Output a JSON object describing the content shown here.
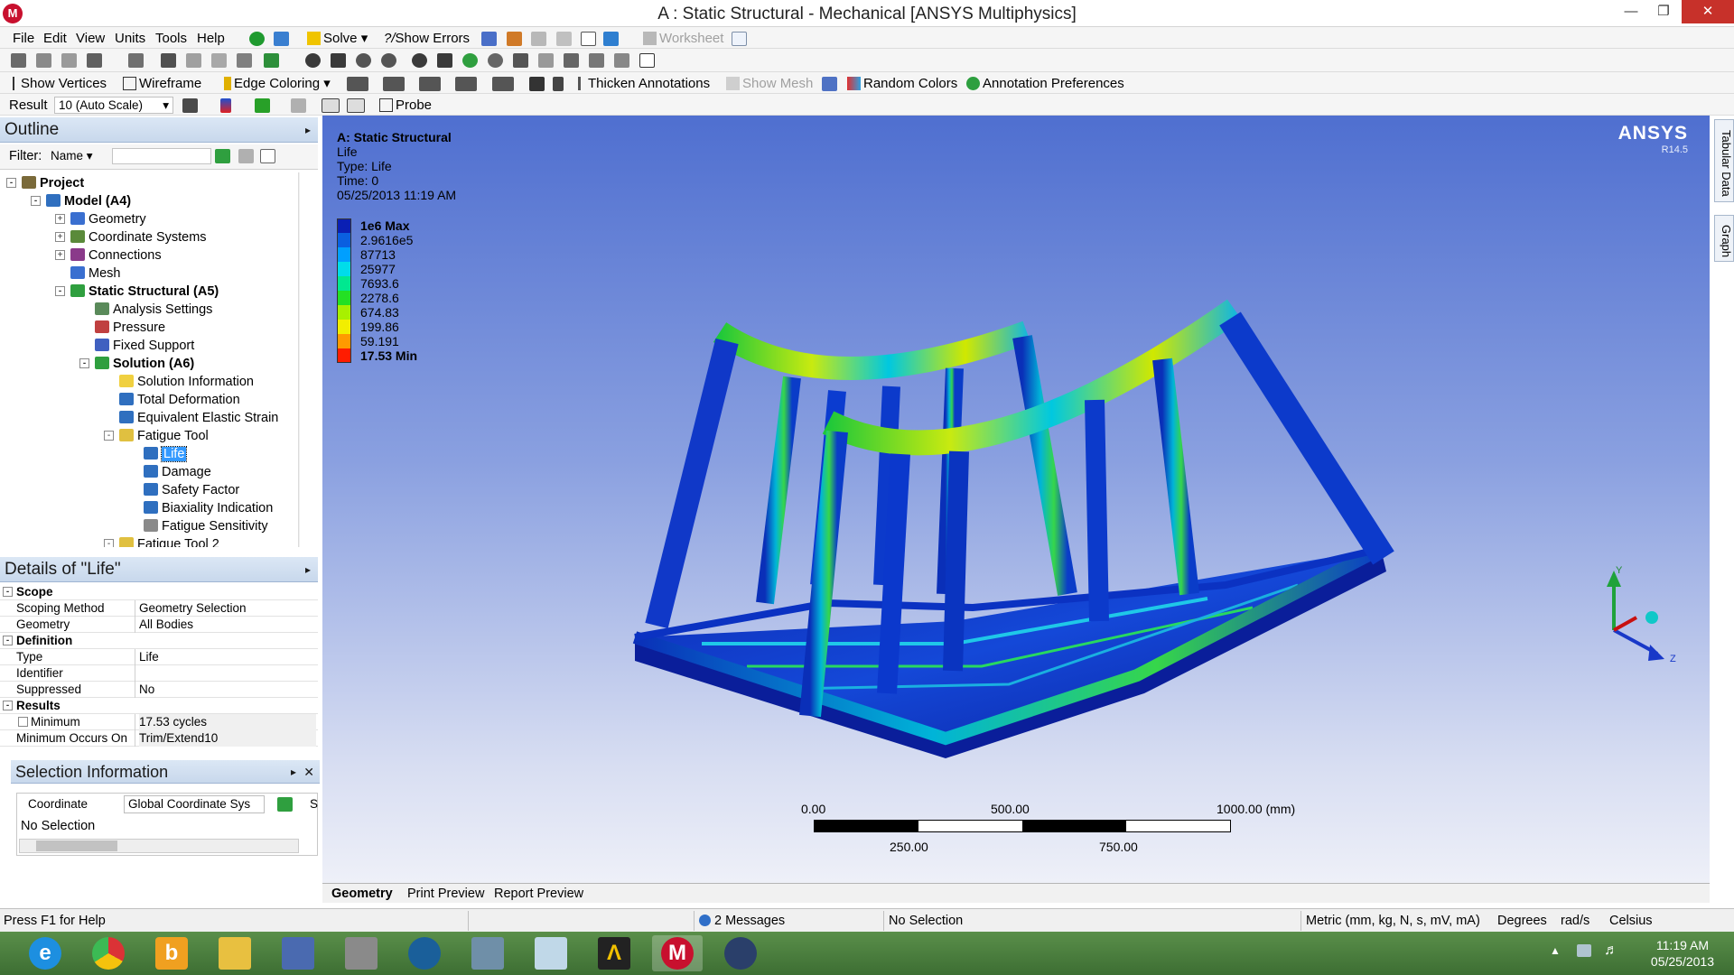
{
  "window": {
    "title": "A : Static Structural - Mechanical [ANSYS Multiphysics]",
    "app_icon_letter": "M"
  },
  "menu": {
    "items": [
      "File",
      "Edit",
      "View",
      "Units",
      "Tools",
      "Help"
    ],
    "solve": "Solve",
    "show_errors": "Show Errors",
    "worksheet": "Worksheet"
  },
  "toolbar2": {},
  "toolbar3": {
    "show_vertices": "Show Vertices",
    "wireframe": "Wireframe",
    "edge_coloring": "Edge Coloring",
    "thicken_annotations": "Thicken Annotations",
    "show_mesh": "Show Mesh",
    "random_colors": "Random Colors",
    "annotation_preferences": "Annotation Preferences"
  },
  "result_bar": {
    "label": "Result",
    "scale_value": "10 (Auto Scale)",
    "probe": "Probe"
  },
  "outline": {
    "title": "Outline",
    "filter_label": "Filter:",
    "filter_value": "Name",
    "tree": [
      {
        "label": "Project",
        "bold": true
      },
      {
        "label": "Model (A4)",
        "bold": true
      },
      {
        "label": "Geometry"
      },
      {
        "label": "Coordinate Systems"
      },
      {
        "label": "Connections"
      },
      {
        "label": "Mesh"
      },
      {
        "label": "Static Structural (A5)",
        "bold": true
      },
      {
        "label": "Analysis Settings"
      },
      {
        "label": "Pressure"
      },
      {
        "label": "Fixed Support"
      },
      {
        "label": "Solution (A6)",
        "bold": true
      },
      {
        "label": "Solution Information"
      },
      {
        "label": "Total Deformation"
      },
      {
        "label": "Equivalent Elastic Strain"
      },
      {
        "label": "Fatigue Tool"
      },
      {
        "label": "Life",
        "selected": true
      },
      {
        "label": "Damage"
      },
      {
        "label": "Safety Factor"
      },
      {
        "label": "Biaxiality Indication"
      },
      {
        "label": "Fatigue Sensitivity"
      },
      {
        "label": "Fatigue Tool 2"
      }
    ]
  },
  "details": {
    "title": "Details of \"Life\"",
    "groups": [
      {
        "name": "Scope",
        "rows": [
          [
            "Scoping Method",
            "Geometry Selection"
          ],
          [
            "Geometry",
            "All Bodies"
          ]
        ]
      },
      {
        "name": "Definition",
        "rows": [
          [
            "Type",
            "Life"
          ],
          [
            "Identifier",
            ""
          ],
          [
            "Suppressed",
            "No"
          ]
        ]
      },
      {
        "name": "Results",
        "rows": [
          [
            "Minimum",
            "17.53 cycles"
          ],
          [
            "Minimum Occurs On",
            "Trim/Extend10"
          ]
        ]
      }
    ]
  },
  "selection_info": {
    "title": "Selection Information",
    "coordinate_label": "Coordinate",
    "coordinate_value": "Global Coordinate Sys",
    "trailing": "S",
    "no_selection": "No Selection"
  },
  "viewport": {
    "info": [
      "A: Static Structural",
      "Life",
      "Type: Life",
      "Time: 0",
      "05/25/2013 11:19 AM"
    ],
    "legend": [
      {
        "label": "1e6 Max",
        "color": "#0a1fb4",
        "bold": true
      },
      {
        "label": "2.9616e5",
        "color": "#0a5fe0"
      },
      {
        "label": "87713",
        "color": "#009fff"
      },
      {
        "label": "25977",
        "color": "#00dcea"
      },
      {
        "label": "7693.6",
        "color": "#00e890"
      },
      {
        "label": "2278.6",
        "color": "#24e024"
      },
      {
        "label": "674.83",
        "color": "#a8f000"
      },
      {
        "label": "199.86",
        "color": "#f2ee00"
      },
      {
        "label": "59.191",
        "color": "#ff9a00"
      },
      {
        "label": "17.53 Min",
        "color": "#ff1c00",
        "bold": true
      }
    ],
    "brand": "ANSYS",
    "version": "R14.5",
    "scale_top": [
      "0.00",
      "500.00",
      "1000.00 (mm)"
    ],
    "scale_bottom": [
      "250.00",
      "750.00"
    ],
    "axis": {
      "y": "Y",
      "z": "Z"
    }
  },
  "side_tabs": [
    "Tabular Data",
    "Graph"
  ],
  "view_tabs": [
    "Geometry",
    "Print Preview",
    "Report Preview"
  ],
  "status": {
    "help": "Press F1 for Help",
    "messages": "2 Messages",
    "selection": "No Selection",
    "units": "Metric (mm, kg, N, s, mV, mA)",
    "angle": "Degrees",
    "rate": "rad/s",
    "temperature": "Celsius"
  },
  "taskbar": {
    "time": "11:19 AM",
    "date": "05/25/2013"
  }
}
